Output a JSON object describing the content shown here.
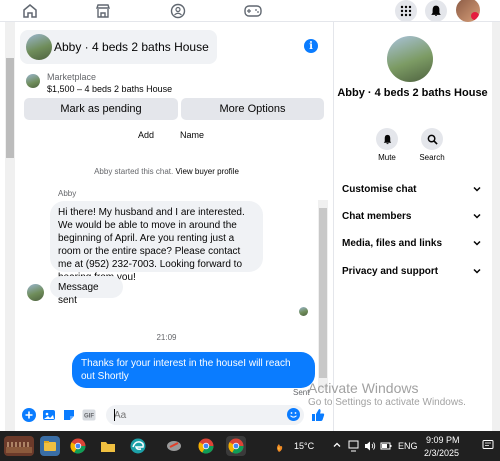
{
  "colors": {
    "accent": "#0a7cff",
    "bubble_in": "#f0f2f5",
    "taskbar": "#202020"
  },
  "topnav": {
    "icons": [
      "home-icon",
      "marketplace-icon",
      "groups-icon",
      "gaming-icon",
      "menu-grid-icon",
      "bell-icon",
      "profile-avatar"
    ]
  },
  "chat": {
    "title": "Abby · 4 beds 2 baths House",
    "marketplace_label": "Marketplace",
    "listing": "$1,500 – 4 beds 2 baths House",
    "mark_pending_label": "Mark as pending",
    "more_options_label": "More Options",
    "add_label": "Add",
    "name_label": "Name",
    "started_text": "Abby started this chat.",
    "view_profile_label": "View buyer profile",
    "sender_name": "Abby",
    "message_1": "Hi there! My husband and I are interested. We would be able to move in around the beginning of April. Are you renting just a room or the entire space? Please contact me at (952) 232-7003. Looking forward to hearing from you!",
    "message_2": "Message sent",
    "timestamp": "21:09",
    "outgoing_message": "Thanks for your interest in the houseI will reach out Shortly",
    "sent_label": "Sent",
    "input_placeholder": "Aa"
  },
  "details": {
    "title": "Abby · 4 beds 2 baths House",
    "mute_label": "Mute",
    "search_label": "Search",
    "sections": [
      "Customise chat",
      "Chat members",
      "Media, files and links",
      "Privacy and support"
    ]
  },
  "watermark": {
    "line1": "Activate Windows",
    "line2": "Go to Settings to activate Windows."
  },
  "taskbar": {
    "temperature": "15°C",
    "language": "ENG",
    "time": "9:09 PM",
    "date": "2/3/2025"
  }
}
